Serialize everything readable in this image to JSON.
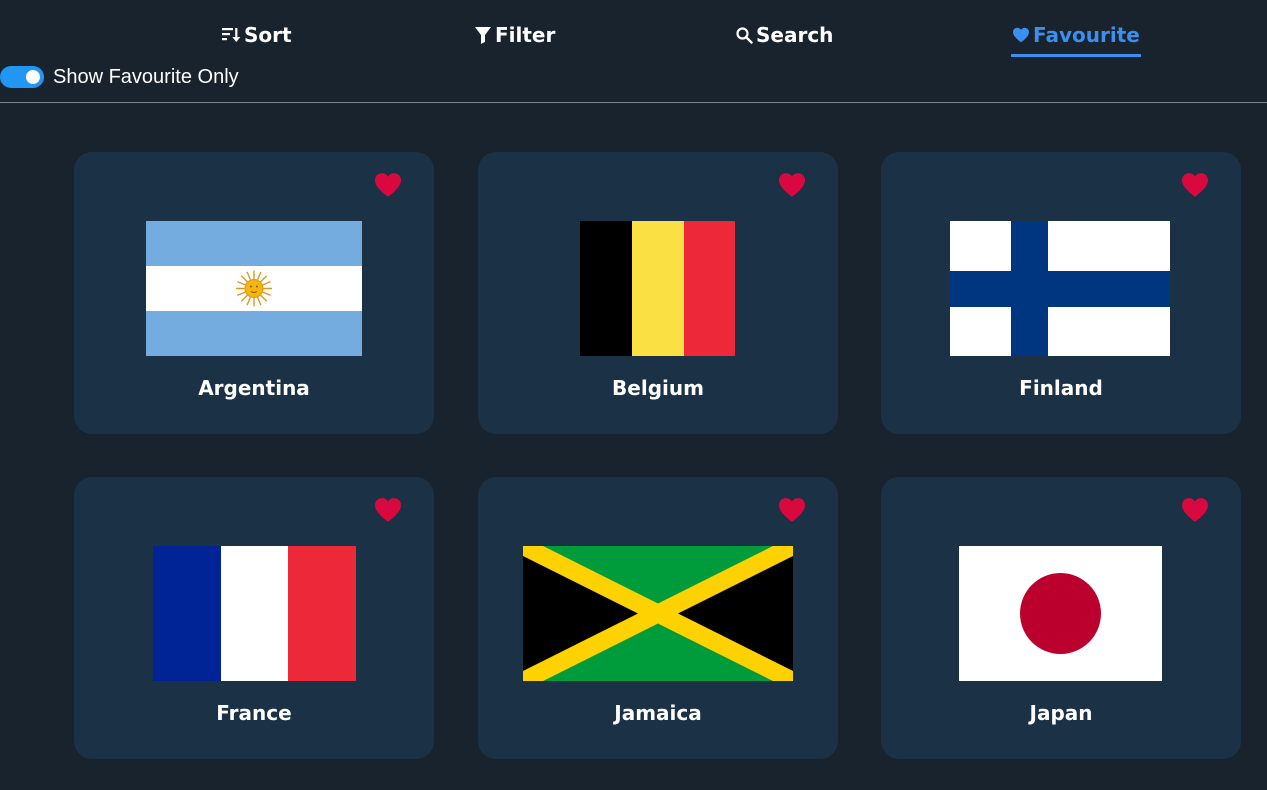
{
  "nav": {
    "tabs": [
      {
        "label": "Sort",
        "icon": "sort-icon"
      },
      {
        "label": "Filter",
        "icon": "filter-icon"
      },
      {
        "label": "Search",
        "icon": "search-icon"
      },
      {
        "label": "Favourite",
        "icon": "heart-icon",
        "active": true
      }
    ]
  },
  "toggle": {
    "label": "Show Favourite Only",
    "on": true
  },
  "colors": {
    "accent": "#3b8ff0",
    "heart": "#d9083e",
    "card": "#1b3246",
    "background": "#18232d"
  },
  "countries": [
    {
      "name": "Argentina",
      "favourite": true
    },
    {
      "name": "Belgium",
      "favourite": true
    },
    {
      "name": "Finland",
      "favourite": true
    },
    {
      "name": "France",
      "favourite": true
    },
    {
      "name": "Jamaica",
      "favourite": true
    },
    {
      "name": "Japan",
      "favourite": true
    }
  ]
}
